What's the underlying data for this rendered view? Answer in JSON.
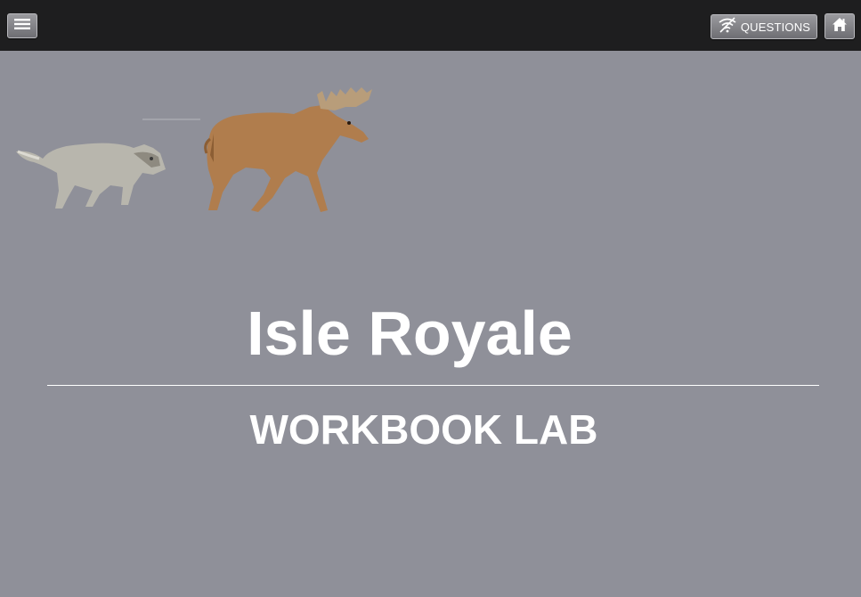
{
  "toolbar": {
    "menu_icon": "hamburger-menu-icon",
    "questions_icon": "no-signal-icon",
    "questions_label": "QUESTIONS",
    "home_icon": "home-icon"
  },
  "hero": {
    "animals": [
      "wolf",
      "moose"
    ]
  },
  "main": {
    "title": "Isle Royale",
    "subtitle": "WORKBOOK LAB"
  },
  "colors": {
    "background": "#8f9099",
    "topbar": "#1e1e1f",
    "text": "#ffffff",
    "wolf": "#b8b6ad",
    "moose": "#b07d4d"
  }
}
